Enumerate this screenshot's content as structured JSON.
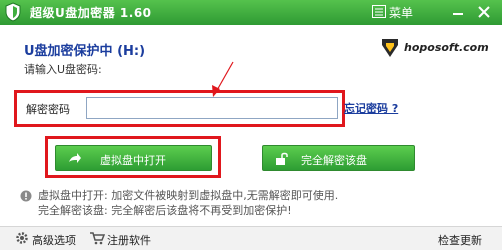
{
  "titlebar": {
    "title": "超级U盘加密器  1.60",
    "menu_label": "菜单",
    "app_icon": "shield-icon",
    "accent_color": "#3fae3f"
  },
  "main": {
    "heading": "U盘加密保护中 (H:)",
    "prompt": "请输入U盘密码:",
    "logo_text": "hoposoft.com",
    "password_label": "解密密码",
    "password_value": "",
    "forgot_link": "忘记密码 ?",
    "open_button": "虚拟盘中打开",
    "decrypt_button": "完全解密该盘",
    "info_line1": "虚拟盘中打开: 加密文件被映射到虚拟盘中,无需解密即可使用.",
    "info_line2": "完全解密该盘: 完全解密后该盘将不再受到加密保护!",
    "highlight_color": "#e0171d"
  },
  "footer": {
    "advanced": "高级选项",
    "register": "注册软件",
    "update": "检查更新"
  }
}
